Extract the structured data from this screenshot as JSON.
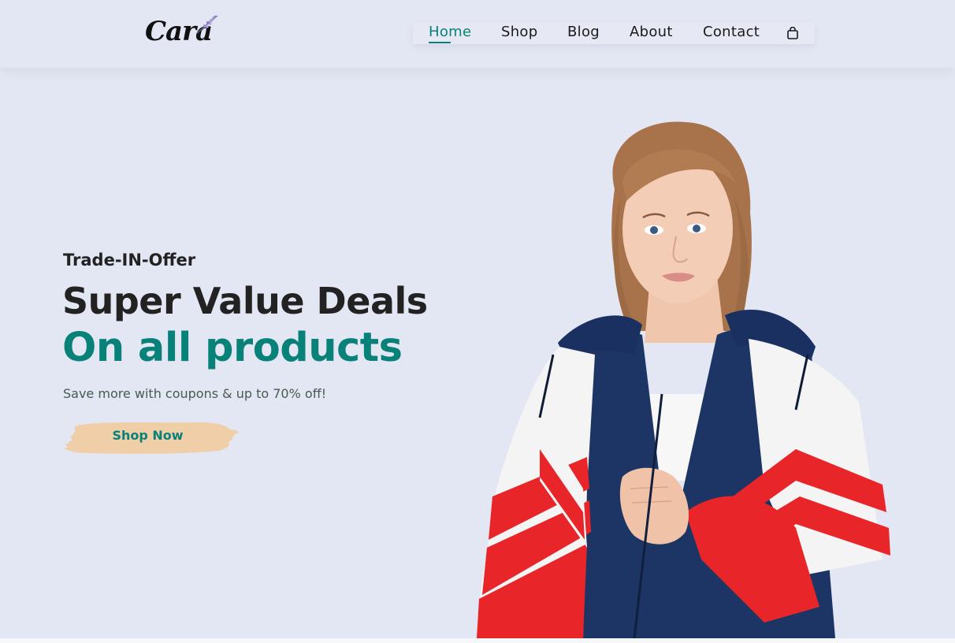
{
  "brand": {
    "name": "Cara"
  },
  "nav": {
    "items": [
      {
        "label": "Home",
        "active": true
      },
      {
        "label": "Shop",
        "active": false
      },
      {
        "label": "Blog",
        "active": false
      },
      {
        "label": "About",
        "active": false
      },
      {
        "label": "Contact",
        "active": false
      }
    ],
    "cart_icon": "shopping-bag-icon"
  },
  "hero": {
    "offer": "Trade-IN-Offer",
    "headline_1": "Super Value Deals",
    "headline_2": "On all products",
    "subtext": "Save more with coupons & up to 70% off!",
    "cta_label": "Shop Now"
  },
  "colors": {
    "background": "#e3e6f3",
    "accent": "#088178",
    "button_bg": "#f0cfa8",
    "text_dark": "#222222"
  }
}
